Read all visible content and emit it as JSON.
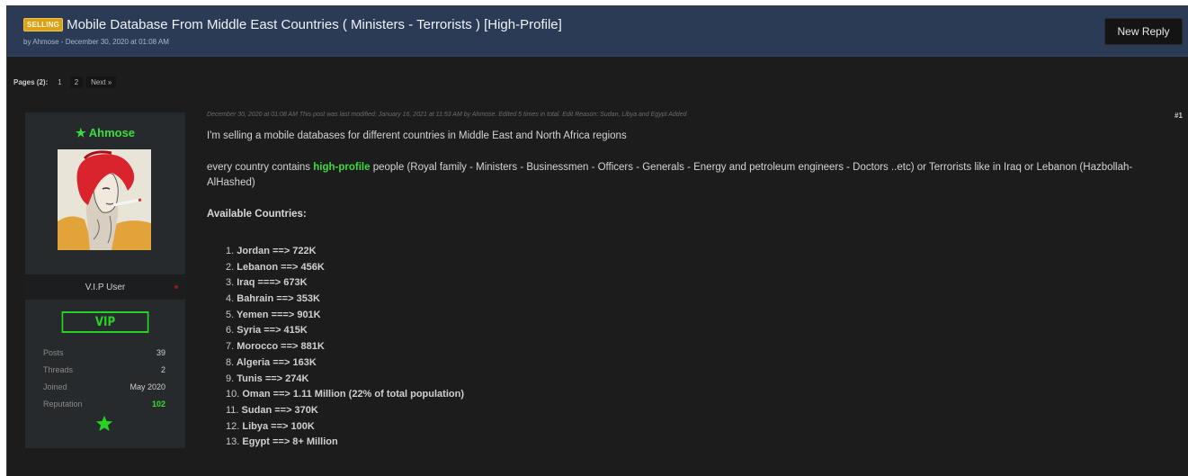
{
  "header": {
    "badge": "SELLING",
    "title": "Mobile Database From Middle East Countries ( Ministers - Terrorists ) [High-Profile]",
    "byline": "by Ahmose - December 30, 2020 at 01:08 AM",
    "new_reply_label": "New Reply"
  },
  "pagination": {
    "label": "Pages (2):",
    "pages": [
      "1",
      "2"
    ],
    "next_label": "Next »"
  },
  "user": {
    "star": "★",
    "name": "Ahmose",
    "title": "V.I.P User",
    "vip_label": "VIP",
    "stats": [
      {
        "label": "Posts",
        "value": "39"
      },
      {
        "label": "Threads",
        "value": "2"
      },
      {
        "label": "Joined",
        "value": "May 2020"
      },
      {
        "label": "Reputation",
        "value": "102"
      }
    ],
    "accent_color": "#3ddc3d"
  },
  "post": {
    "meta": "December 30, 2020 at 01:08 AM  This post was last modified: January 16, 2021 at 11:53 AM by Ahmose. Edited 5 times in total. Edit Reason: Sudan, Libya and Egypt Added",
    "number": "#1",
    "intro": "I'm selling a mobile databases for different countries in Middle East and North Africa regions",
    "para2_before": "every country contains ",
    "para2_highlight": "high-profile",
    "para2_after": " people (Royal family - Ministers - Businessmen - Officers - Generals - Energy and petroleum engineers - Doctors ..etc) or Terrorists like in Iraq or Lebanon (Hazbollah- AlHashed)",
    "available_heading": "Available Countries:",
    "countries": [
      {
        "num": "1.",
        "text": "Jordan ==> 722K"
      },
      {
        "num": "2.",
        "text": "Lebanon ==> 456K"
      },
      {
        "num": "3.",
        "text": "Iraq ===> 673K"
      },
      {
        "num": "4.",
        "text": "Bahrain ==> 353K"
      },
      {
        "num": "5.",
        "text": "Yemen ===> 901K"
      },
      {
        "num": "6.",
        "text": "Syria ==> 415K"
      },
      {
        "num": "7.",
        "text": "Morocco ==> 881K"
      },
      {
        "num": "8.",
        "text": "Algeria ==> 163K"
      },
      {
        "num": "9.",
        "text": "Tunis ==> 274K"
      },
      {
        "num": "10.",
        "text": "Oman ==> 1.11 Million (22% of total population)"
      },
      {
        "num": "11.",
        "text": "Sudan ==> 370K"
      },
      {
        "num": "12.",
        "text": "Libya ==> 100K"
      },
      {
        "num": "13.",
        "text": "Egypt ==> 8+ Million"
      }
    ]
  }
}
